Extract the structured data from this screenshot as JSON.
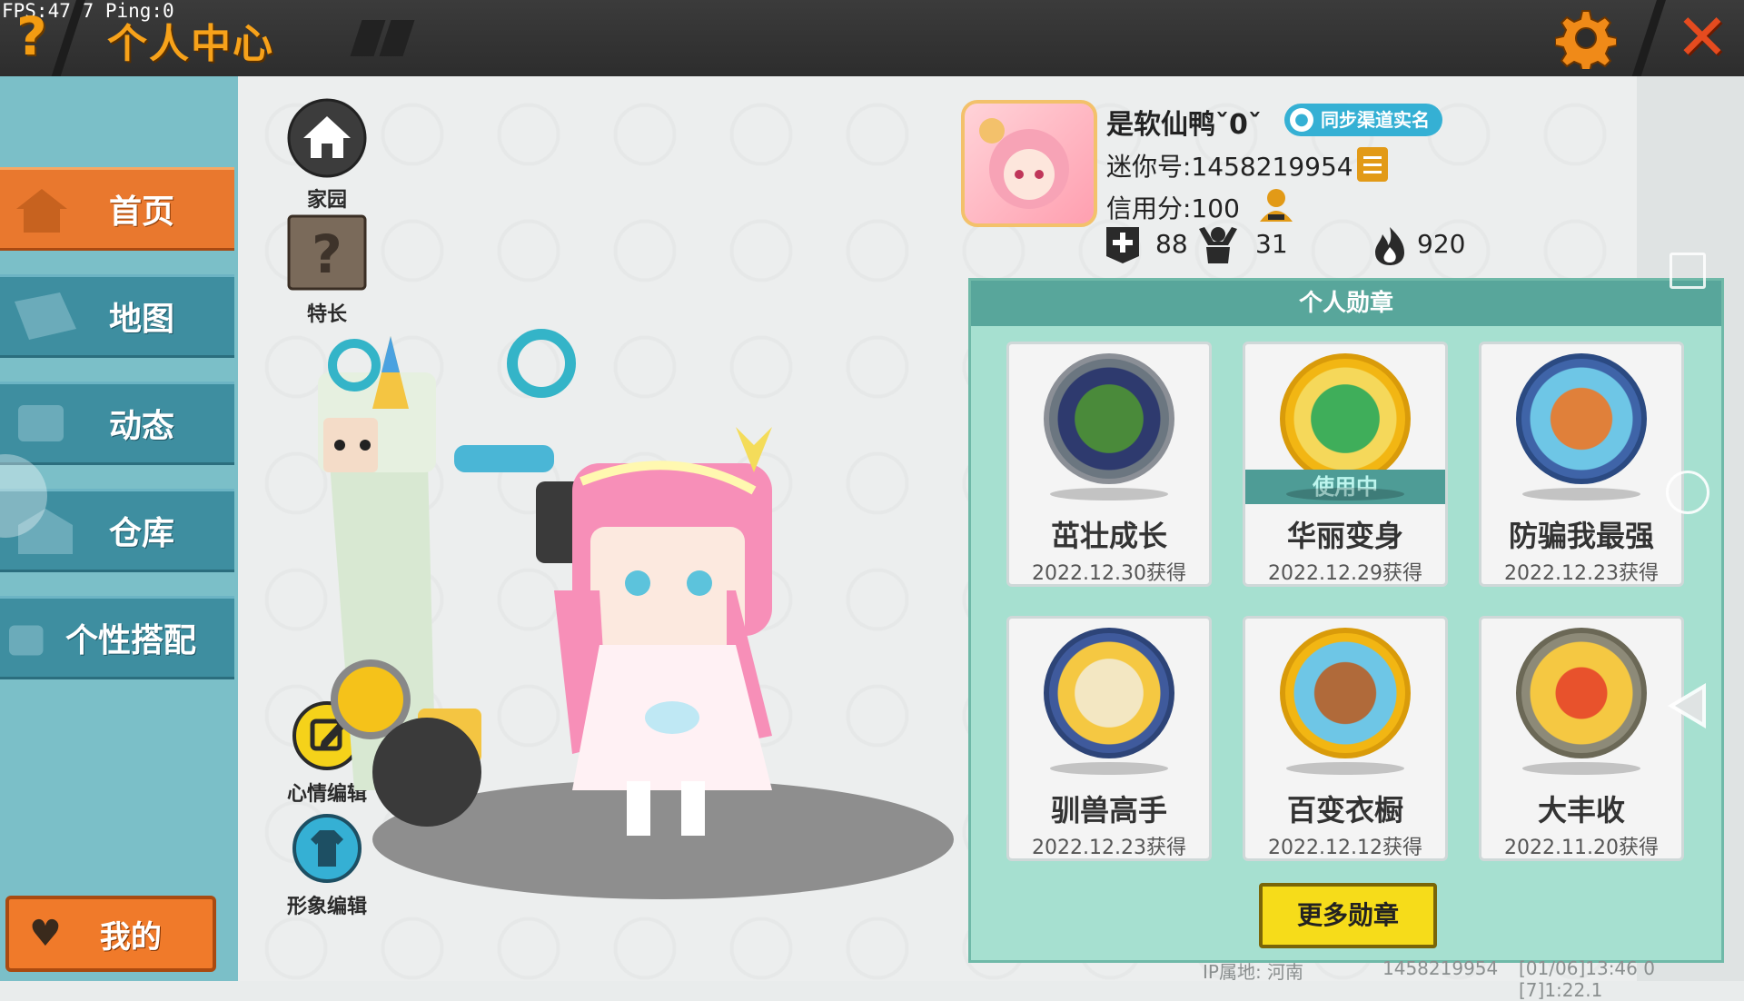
{
  "status": {
    "fps": "FPS:47.7",
    "ping": "Ping:0"
  },
  "header": {
    "help_icon": "?",
    "title": "个人中心",
    "settings_icon": "gear-icon",
    "close_icon": "✕"
  },
  "sidebar": {
    "items": [
      {
        "label": "首页",
        "active": true
      },
      {
        "label": "地图",
        "active": false
      },
      {
        "label": "动态",
        "active": false
      },
      {
        "label": "仓库",
        "active": false
      },
      {
        "label": "个性搭配",
        "active": false
      }
    ],
    "mine_label": "我的"
  },
  "quick_buttons": {
    "home": "家园",
    "talent": "特长",
    "mood_edit": "心情编辑",
    "image_edit": "形象编辑"
  },
  "profile": {
    "name": "是软仙鸭ˇ0ˇ",
    "sync_badge": "同步渠道实名",
    "mini_id": "迷你号:1458219954",
    "credit": "信用分:100",
    "stats": {
      "add": "88",
      "fans": "31",
      "heat": "920"
    }
  },
  "badges": {
    "title": "个人勋章",
    "items": [
      {
        "name": "茁壮成长",
        "date": "2022.12.30获得",
        "in_use": false,
        "color": "#6b7680"
      },
      {
        "name": "华丽变身",
        "date": "2022.12.29获得",
        "in_use": true,
        "in_use_label": "使用中",
        "color": "#f2b613"
      },
      {
        "name": "防骗我最强",
        "date": "2022.12.23获得",
        "in_use": false,
        "color": "#3f64a8"
      },
      {
        "name": "驯兽高手",
        "date": "2022.12.23获得",
        "in_use": false,
        "color": "#3f5a9c"
      },
      {
        "name": "百变衣橱",
        "date": "2022.12.12获得",
        "in_use": false,
        "color": "#f2b613"
      },
      {
        "name": "大丰收",
        "date": "2022.11.20获得",
        "in_use": false,
        "color": "#8d8a78"
      }
    ],
    "more_label": "更多勋章"
  },
  "footer": {
    "ip": "IP属地: 河南",
    "uid": "1458219954",
    "time": "[01/06]13:46 0 [7]1:22.1"
  },
  "colors": {
    "accent": "#e9782e",
    "nav": "#3e8ea0",
    "panel": "#a6e0d0",
    "title": "#f7a21a"
  }
}
